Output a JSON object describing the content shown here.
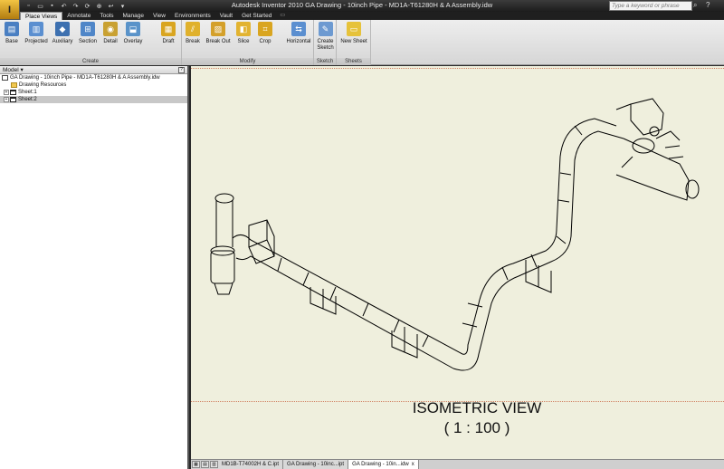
{
  "window": {
    "title": "Autodesk Inventor 2010    GA Drawing - 10inch Pipe - MD1A-T61280H & A Assembly.idw"
  },
  "search": {
    "placeholder": "Type a keyword or phrase"
  },
  "ribbon": {
    "tabs": [
      "Place Views",
      "Annotate",
      "Tools",
      "Manage",
      "View",
      "Environments",
      "Vault",
      "Get Started"
    ],
    "panels": {
      "create": {
        "label": "Create",
        "buttons": [
          "Base",
          "Projected",
          "Auxiliary",
          "Section",
          "Detail",
          "Overlay"
        ]
      },
      "modify": {
        "label": "Modify",
        "buttons": [
          "Draft",
          "Break",
          "Break Out",
          "Slice",
          "Crop",
          "Horizontal"
        ]
      },
      "sketch": {
        "label": "Sketch",
        "button_line1": "Create",
        "button_line2": "Sketch"
      },
      "sheets": {
        "label": "Sheets",
        "button": "New Sheet"
      }
    }
  },
  "browser": {
    "header": "Model",
    "close_label": "?",
    "items": [
      {
        "label": "GA Drawing - 10inch Pipe - MD1A-T61280H & A Assembly.idw"
      },
      {
        "label": "Drawing Resources"
      },
      {
        "label": "Sheet:1"
      },
      {
        "label": "Sheet:2"
      }
    ]
  },
  "drawing": {
    "view_title": "ISOMETRIC VIEW",
    "view_scale": "( 1 : 100 )"
  },
  "doc_tabs": [
    {
      "label": "MD1B-T74002H & C.ipt"
    },
    {
      "label": "GA Drawing - 10inc...ipt"
    },
    {
      "label": "GA Drawing - 10in...idw",
      "close": "x"
    }
  ],
  "colors": {
    "accent": "#f2c443",
    "canvas": "#efefdd",
    "titlebar": "#2a2a2a",
    "sheet_border": "#d08060"
  }
}
